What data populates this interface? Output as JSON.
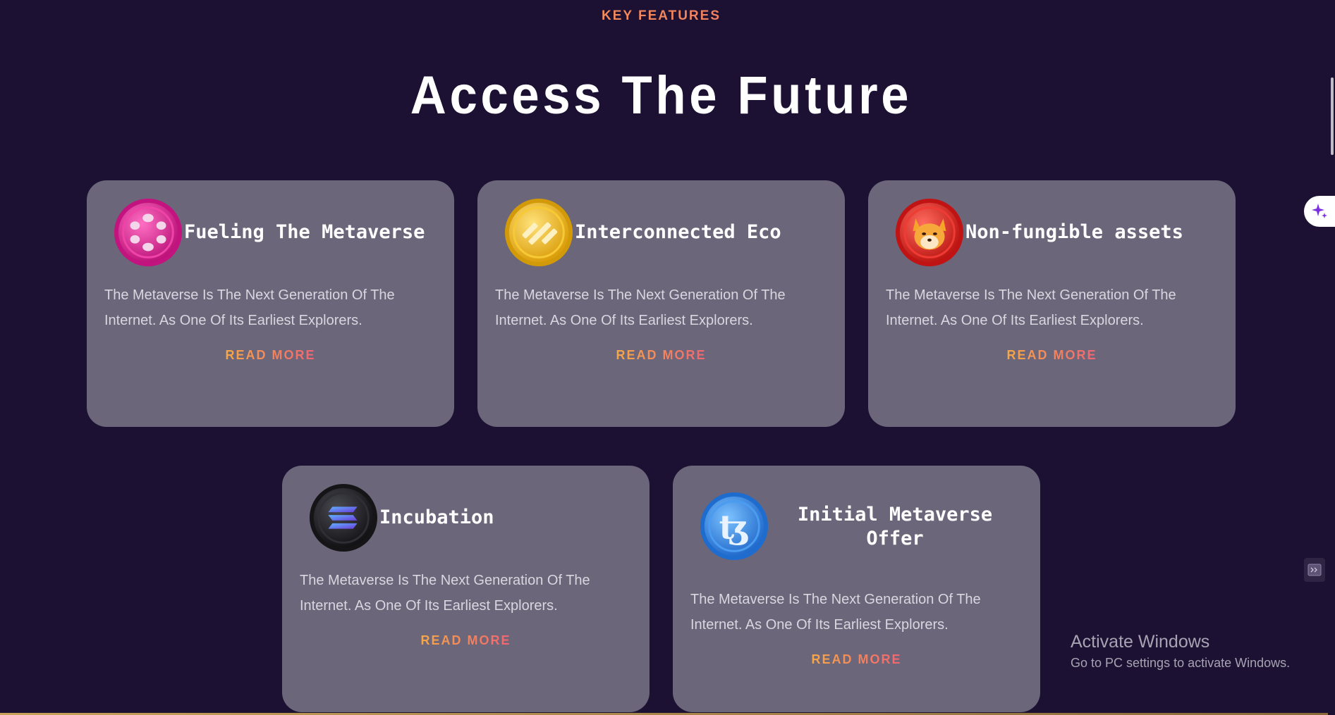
{
  "section": {
    "eyebrow": "KEY FEATURES",
    "title": "Access The Future"
  },
  "cards": [
    {
      "title": "Fueling The Metaverse",
      "description": "The Metaverse Is The Next Generation Of The Internet. As One Of Its Earliest Explorers.",
      "link_label": "READ MORE",
      "icon": "polkadot-coin-icon",
      "icon_color": "#e0289b"
    },
    {
      "title": "Interconnected Eco",
      "description": "The Metaverse Is The Next Generation Of The Internet. As One Of Its Earliest Explorers.",
      "link_label": "READ MORE",
      "icon": "binance-coin-icon",
      "icon_color": "#f0b90b"
    },
    {
      "title": "Non-fungible assets",
      "description": "The Metaverse Is The Next Generation Of The Internet. As One Of Its Earliest Explorers.",
      "link_label": "READ MORE",
      "icon": "shiba-inu-coin-icon",
      "icon_color": "#e42d2d"
    },
    {
      "title": "Incubation",
      "description": "The Metaverse Is The Next Generation Of The Internet. As One Of Its Earliest Explorers.",
      "link_label": "READ MORE",
      "icon": "solana-coin-icon",
      "icon_color": "#1b1b1f"
    },
    {
      "title": "Initial Metaverse Offer",
      "description": "The Metaverse Is The Next Generation Of The Internet. As One Of Its Earliest Explorers.",
      "link_label": "READ MORE",
      "icon": "tezos-coin-icon",
      "icon_color": "#2f86e6"
    }
  ],
  "overlay": {
    "activate_title": "Activate Windows",
    "activate_subtitle": "Go to PC settings to activate Windows.",
    "ai_badge_icon": "sparkle-icon",
    "side_widget_icon": "screen-icon"
  },
  "colors": {
    "background": "#1c1133",
    "card": "#6b6679",
    "accent_start": "#f6bd3a",
    "accent_end": "#ef4f80"
  }
}
